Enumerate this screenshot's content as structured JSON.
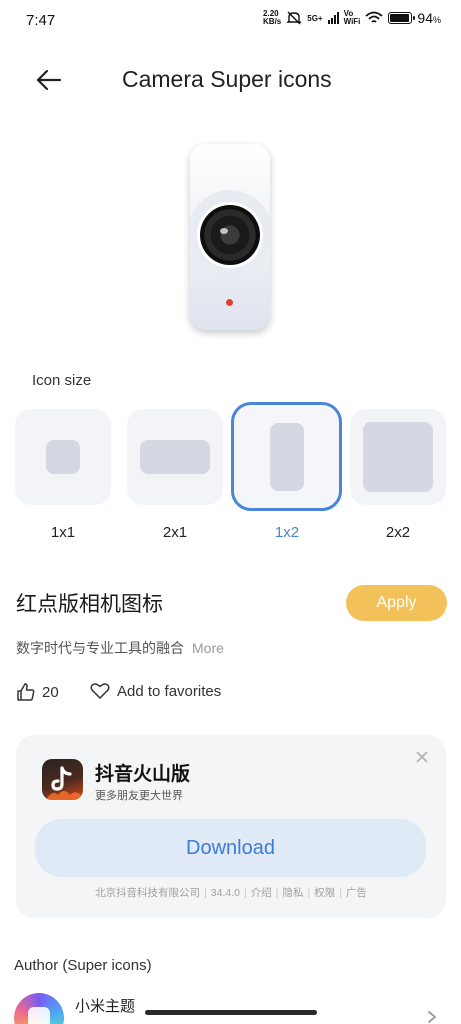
{
  "status_bar": {
    "time": "7:47",
    "net_speed_value": "2.20",
    "net_speed_unit": "KB/s",
    "network_type": "5G+",
    "vowifi_top": "Vo",
    "vowifi_bottom": "WiFi",
    "battery_percent": "94",
    "battery_symbol": "%",
    "battery_level": 0.94
  },
  "header": {
    "title": "Camera Super icons",
    "back_icon": "arrow-left-icon"
  },
  "icon_size": {
    "label": "Icon size",
    "options": [
      {
        "label": "1x1",
        "selected": false
      },
      {
        "label": "2x1",
        "selected": false
      },
      {
        "label": "1x2",
        "selected": true
      },
      {
        "label": "2x2",
        "selected": false
      }
    ]
  },
  "theme": {
    "name": "红点版相机图标",
    "apply_label": "Apply",
    "description": "数字时代与专业工具的融合",
    "more_label": "More",
    "likes_count": "20",
    "favorites_label": "Add to favorites"
  },
  "ad": {
    "app_name": "抖音火山版",
    "tagline": "更多朋友更大世界",
    "download_label": "Download",
    "company": "北京抖音科技有限公司",
    "version": "34.4.0",
    "intro": "介绍",
    "privacy": "隐私",
    "permissions": "权限",
    "ad_tag": "广告"
  },
  "author": {
    "label": "Author (Super icons)",
    "name": "小米主题"
  },
  "colors": {
    "accent_blue": "#4a86d8",
    "apply_yellow": "#f2c15a",
    "download_bg": "#e0e9f6",
    "preview_dot_red": "#e0402c"
  }
}
